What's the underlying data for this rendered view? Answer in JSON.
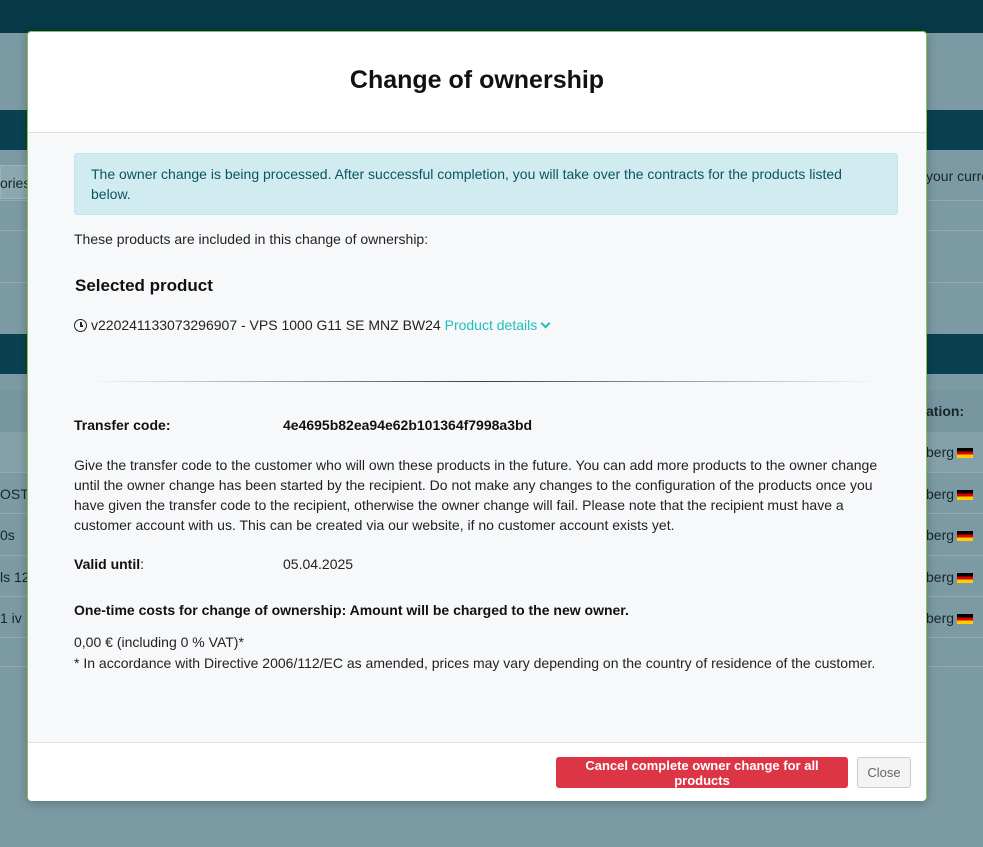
{
  "background": {
    "left_snippets": [
      "ories",
      "OST",
      "0s",
      "ls 12",
      "1 iv"
    ],
    "right_header": "ation:",
    "right_top_text": "your curre",
    "location_cells": [
      "berg",
      "berg",
      "berg",
      "berg",
      "berg"
    ]
  },
  "modal": {
    "title": "Change of ownership",
    "alert_text": "The owner change is being processed. After successful completion, you will take over the contracts for the products listed below.",
    "lead_text": "These products are included in this change of ownership:",
    "selected_product_heading": "Selected product",
    "product_name": "v220241133073296907 - VPS 1000 G11 SE MNZ BW24",
    "product_details_link": "Product details",
    "transfer_code_label": "Transfer code:",
    "transfer_code_value": "4e4695b82ea94e62b101364f7998a3bd",
    "instructions": "Give the transfer code to the customer who will own these products in the future. You can add more products to the owner change until the owner change has been started by the recipient. Do not make any changes to the configuration of the products once you have given the transfer code to the recipient, otherwise the owner change will fail. Please note that the recipient must have a customer account with us. This can be created via our website, if no customer account exists yet.",
    "valid_until_label": "Valid until",
    "valid_until_colon": ":",
    "valid_until_value": "05.04.2025",
    "costs_heading": "One-time costs for change of ownership: Amount will be charged to the new owner.",
    "costs_amount": "0,00 € (including 0 % VAT)*",
    "costs_footnote": "* In accordance with Directive 2006/112/EC as amended, prices may vary depending on the country of residence of the customer.",
    "cancel_button": "Cancel complete owner change for all products",
    "close_button": "Close"
  },
  "colors": {
    "accent_link": "#1fbfbf",
    "danger": "#dc3545",
    "alert_bg": "#d1ecf1",
    "topbar": "#073a46"
  },
  "icons": [
    "clock-icon",
    "chevron-down-icon",
    "germany-flag-icon"
  ]
}
